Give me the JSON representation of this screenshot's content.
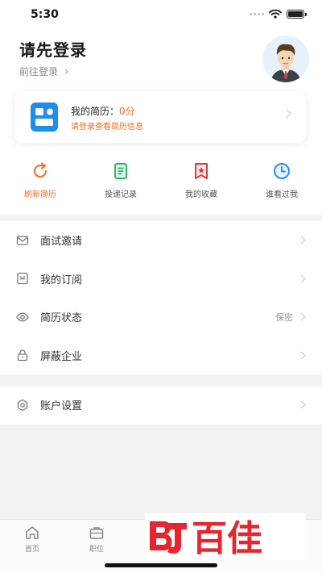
{
  "status": {
    "time": "5:30"
  },
  "profile": {
    "title": "请先登录",
    "subtitle": "前往登录",
    "subtitle_arrow": "›"
  },
  "resume": {
    "label": "我的简历：",
    "score": "0分",
    "hint": "请登录查看简历信息"
  },
  "quick_actions": [
    {
      "label": "刷新简历",
      "icon": "refresh-icon",
      "color": "#f07a2a"
    },
    {
      "label": "投递记录",
      "icon": "document-icon",
      "color": "#2fb56a"
    },
    {
      "label": "我的收藏",
      "icon": "bookmark-star-icon",
      "color": "#e0393a"
    },
    {
      "label": "谁看过我",
      "icon": "clock-icon",
      "color": "#2a8fe8"
    }
  ],
  "menu": {
    "group1": [
      {
        "label": "面试邀请",
        "icon": "mail-icon"
      },
      {
        "label": "我的订阅",
        "icon": "subscribe-icon"
      },
      {
        "label": "简历状态",
        "icon": "eye-icon",
        "value": "保密"
      },
      {
        "label": "屏蔽企业",
        "icon": "lock-icon"
      }
    ],
    "group2": [
      {
        "label": "账户设置",
        "icon": "gear-icon"
      }
    ]
  },
  "tabbar": [
    {
      "label": "首页",
      "icon": "home-icon"
    },
    {
      "label": "职位",
      "icon": "briefcase-icon"
    }
  ],
  "colors": {
    "accent": "#f06e26",
    "resume_blue": "#1f8eea",
    "watermark_red": "#e8242e"
  }
}
